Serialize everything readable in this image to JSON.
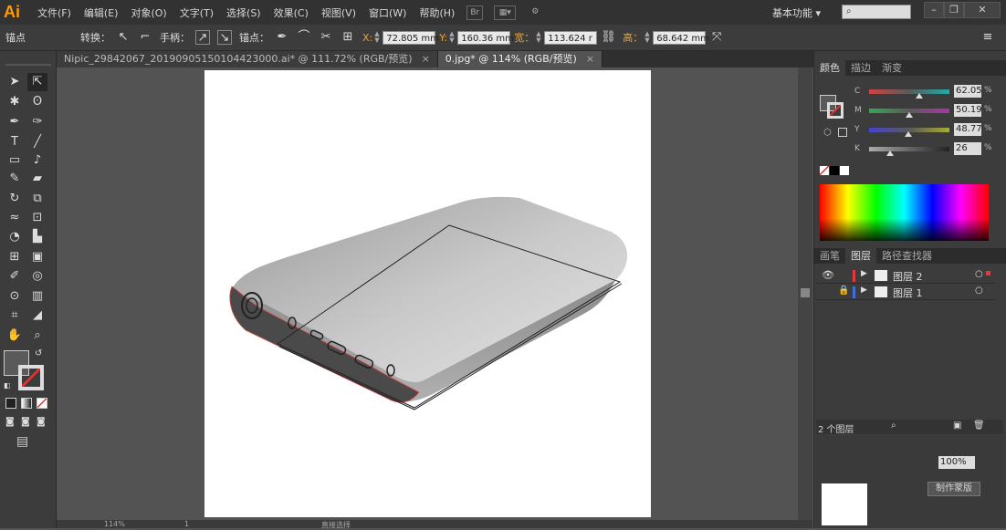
{
  "app": {
    "logo": "Ai"
  },
  "menus": [
    "文件(F)",
    "编辑(E)",
    "对象(O)",
    "文字(T)",
    "选择(S)",
    "效果(C)",
    "视图(V)",
    "窗口(W)",
    "帮助(H)"
  ],
  "workspace": "基本功能",
  "control": {
    "mode": "锚点",
    "convert_label": "转换：",
    "handles_label": "手柄：",
    "anchors_label": "锚点：",
    "x_label": "X:",
    "x_value": "72.805 mm",
    "y_label": "Y:",
    "y_value": "160.36 mm",
    "w_label": "宽：",
    "w_value": "113.624 r",
    "h_label": "高：",
    "h_value": "68.642 mm"
  },
  "tabs": [
    {
      "label": "Nipic_29842067_20190905150104423000.ai* @ 111.72% (RGB/预览)",
      "close": "×"
    },
    {
      "label": "0.jpg* @ 114% (RGB/预览)",
      "close": "×"
    }
  ],
  "color_panel": {
    "tabs": [
      "颜色",
      "描边",
      "渐变"
    ],
    "channels": [
      {
        "label": "C",
        "value": "62.05",
        "level": 0.62
      },
      {
        "label": "M",
        "value": "50.19",
        "level": 0.5
      },
      {
        "label": "Y",
        "value": "48.77",
        "level": 0.49
      },
      {
        "label": "K",
        "value": "26",
        "level": 0.26
      }
    ],
    "pct": "%"
  },
  "layers_panel": {
    "tabs": [
      "画笔",
      "图层",
      "路径查找器"
    ],
    "layers": [
      {
        "name": "图层 2",
        "color": "#e0393e"
      },
      {
        "name": "图层 1",
        "color": "#3f6fd8"
      }
    ],
    "count": "2 个图层"
  },
  "lower_panel": {
    "opacity": "100%",
    "make_mask": "制作蒙版"
  },
  "statusbar": {
    "zoom": "114%",
    "page": "1",
    "tool": "直接选择"
  }
}
